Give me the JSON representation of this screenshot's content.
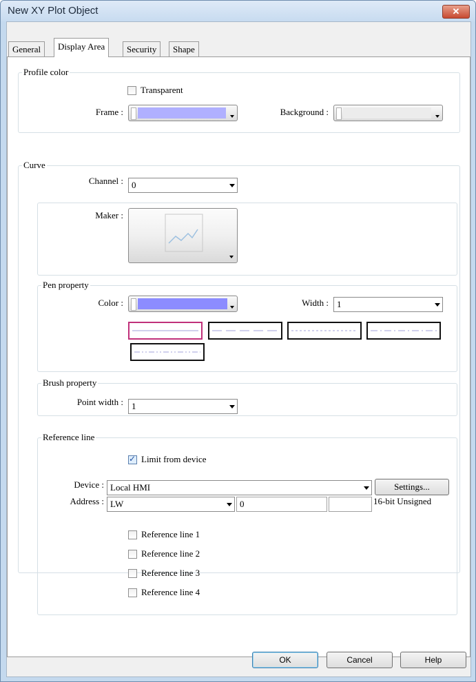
{
  "window": {
    "title": "New XY Plot Object",
    "close_icon": "close-icon"
  },
  "tabs": [
    {
      "label": "General"
    },
    {
      "label": "Display Area",
      "active": true
    },
    {
      "label": "Security"
    },
    {
      "label": "Shape"
    }
  ],
  "profile_color": {
    "group_label": "Profile color",
    "transparent_label": "Transparent",
    "transparent_checked": false,
    "frame_label": "Frame :",
    "frame_color": "#b0b0ff",
    "background_label": "Background :",
    "background_color": "#ececec"
  },
  "curve": {
    "group_label": "Curve",
    "channel_label": "Channel :",
    "channel_value": "0",
    "maker_label": "Maker :"
  },
  "pen": {
    "group_label": "Pen property",
    "color_label": "Color :",
    "color_value": "#8c8cff",
    "width_label": "Width :",
    "width_value": "1",
    "line_styles": [
      "solid",
      "dash",
      "dot",
      "dash-dot",
      "dash-dot-dot"
    ],
    "selected_style": "solid",
    "style_color": "#a0a0d8"
  },
  "brush": {
    "group_label": "Brush property",
    "point_width_label": "Point width :",
    "point_width_value": "1"
  },
  "reference": {
    "group_label": "Reference line",
    "limit_label": "Limit from device",
    "limit_checked": true,
    "device_label": "Device :",
    "device_value": "Local HMI",
    "settings_label": "Settings...",
    "address_label": "Address :",
    "address_type": "LW",
    "address_value": "0",
    "address_extra": "",
    "data_format": "16-bit Unsigned",
    "lines": [
      {
        "label": "Reference line 1",
        "checked": false
      },
      {
        "label": "Reference line 2",
        "checked": false
      },
      {
        "label": "Reference line 3",
        "checked": false
      },
      {
        "label": "Reference line 4",
        "checked": false
      }
    ]
  },
  "buttons": {
    "ok": "OK",
    "cancel": "Cancel",
    "help": "Help"
  }
}
